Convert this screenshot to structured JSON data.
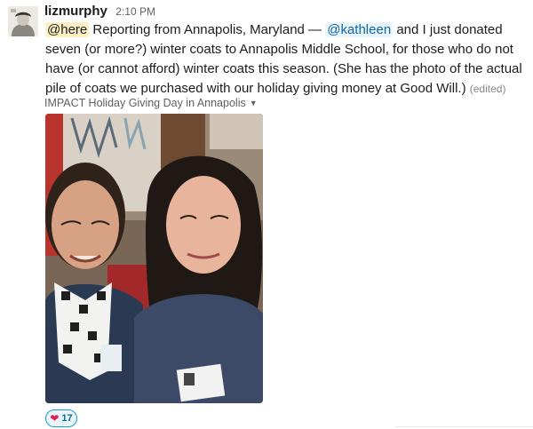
{
  "message": {
    "author": "lizmurphy",
    "time": "2:10 PM",
    "mention_here": "@here",
    "text_part1": " Reporting from Annapolis, Maryland — ",
    "mention_user": "@kathleen",
    "text_part2": " and I just donated seven (or more?) winter coats to Annapolis Middle School, for those who do not have (or cannot afford) winter coats this season. (She has the photo of the actual pile of coats we purchased with our holiday giving money at Good Will.) ",
    "edited": "(edited)"
  },
  "attachment": {
    "title": "IMPACT Holiday Giving Day in Annapolis",
    "caret_icon": "caret-down-icon"
  },
  "reaction": {
    "emoji_icon": "heart-icon",
    "count": "17",
    "color": "#e01e5a"
  },
  "colors": {
    "mention_here_bg": "#fcf0c3",
    "mention_user": "#1264a3",
    "reaction_border": "#1d9bd1"
  }
}
